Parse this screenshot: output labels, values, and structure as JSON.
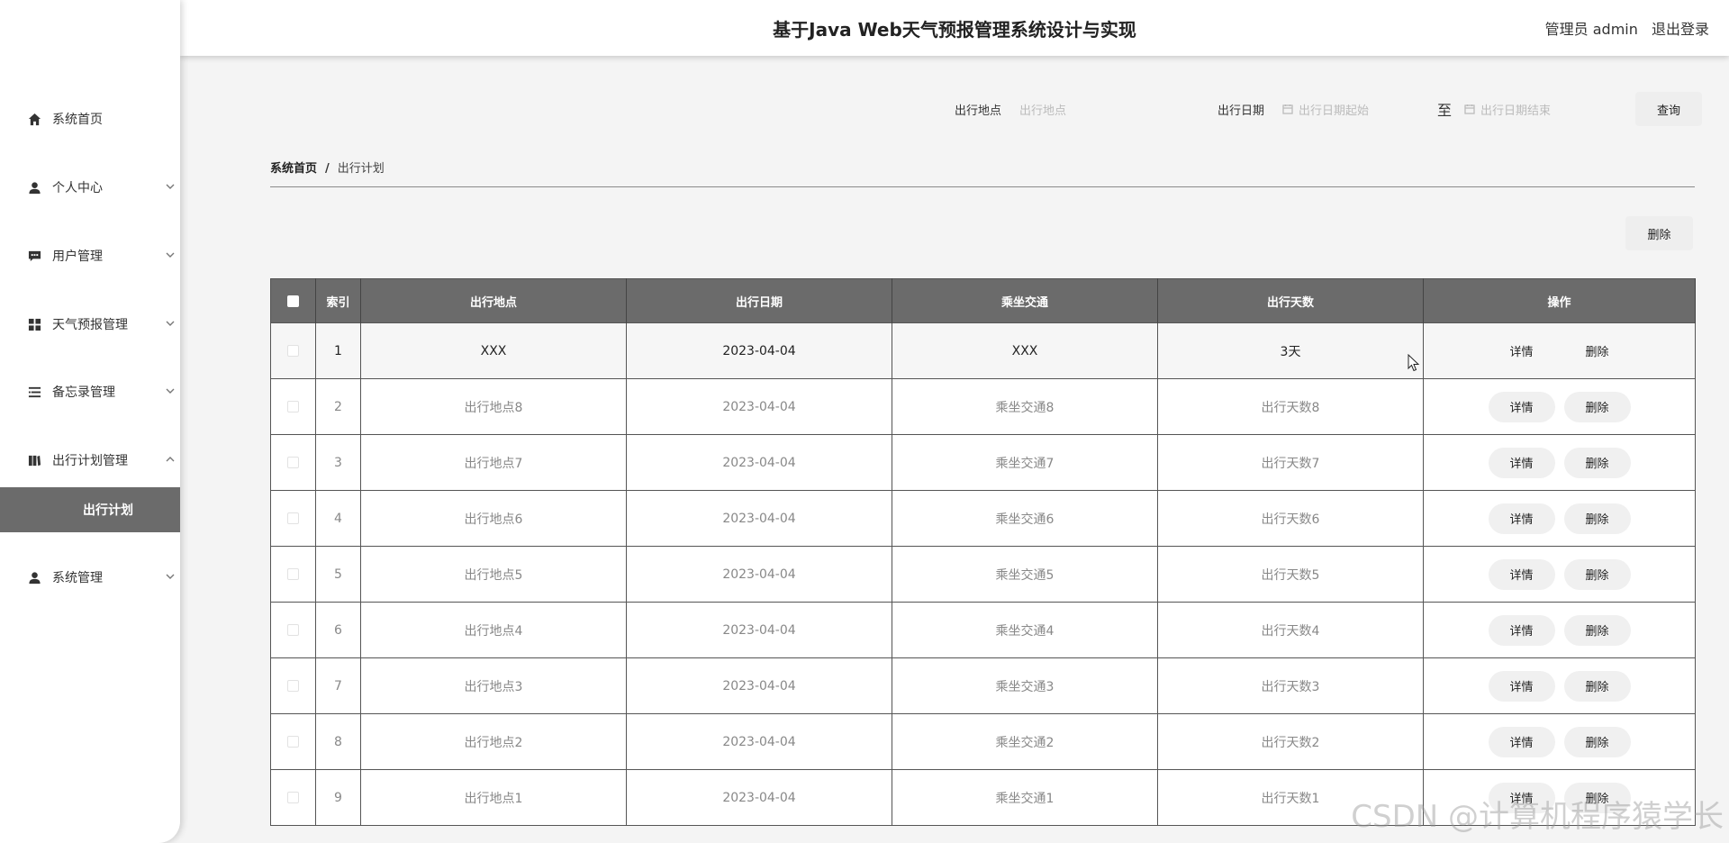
{
  "header": {
    "title": "基于Java Web天气预报管理系统设计与实现",
    "user_label": "管理员 admin",
    "logout_label": "退出登录"
  },
  "sidebar": {
    "items": [
      {
        "label": "系统首页",
        "icon": "home-icon"
      },
      {
        "label": "个人中心",
        "icon": "user-icon"
      },
      {
        "label": "用户管理",
        "icon": "chat-icon"
      },
      {
        "label": "天气预报管理",
        "icon": "grid-icon"
      },
      {
        "label": "备忘录管理",
        "icon": "list-icon"
      },
      {
        "label": "出行计划管理",
        "icon": "book-icon"
      },
      {
        "label": "系统管理",
        "icon": "user-icon"
      }
    ],
    "submenu_active": "出行计划"
  },
  "search": {
    "place_label": "出行地点",
    "place_placeholder": "出行地点",
    "date_label": "出行日期",
    "date_start_placeholder": "出行日期起始",
    "to_label": "至",
    "date_end_placeholder": "出行日期结束",
    "query_label": "查询"
  },
  "breadcrumb": {
    "home": "系统首页",
    "separator": "/",
    "current": "出行计划"
  },
  "toolbar": {
    "delete_label": "删除"
  },
  "table": {
    "headers": [
      "索引",
      "出行地点",
      "出行日期",
      "乘坐交通",
      "出行天数",
      "操作"
    ],
    "detail_label": "详情",
    "delete_label": "删除",
    "rows": [
      {
        "index": "1",
        "place": "XXX",
        "date": "2023-04-04",
        "transport": "XXX",
        "days": "3天"
      },
      {
        "index": "2",
        "place": "出行地点8",
        "date": "2023-04-04",
        "transport": "乘坐交通8",
        "days": "出行天数8"
      },
      {
        "index": "3",
        "place": "出行地点7",
        "date": "2023-04-04",
        "transport": "乘坐交通7",
        "days": "出行天数7"
      },
      {
        "index": "4",
        "place": "出行地点6",
        "date": "2023-04-04",
        "transport": "乘坐交通6",
        "days": "出行天数6"
      },
      {
        "index": "5",
        "place": "出行地点5",
        "date": "2023-04-04",
        "transport": "乘坐交通5",
        "days": "出行天数5"
      },
      {
        "index": "6",
        "place": "出行地点4",
        "date": "2023-04-04",
        "transport": "乘坐交通4",
        "days": "出行天数4"
      },
      {
        "index": "7",
        "place": "出行地点3",
        "date": "2023-04-04",
        "transport": "乘坐交通3",
        "days": "出行天数3"
      },
      {
        "index": "8",
        "place": "出行地点2",
        "date": "2023-04-04",
        "transport": "乘坐交通2",
        "days": "出行天数2"
      },
      {
        "index": "9",
        "place": "出行地点1",
        "date": "2023-04-04",
        "transport": "乘坐交通1",
        "days": "出行天数1"
      }
    ]
  },
  "watermark": "CSDN @计算机程序猿学长"
}
